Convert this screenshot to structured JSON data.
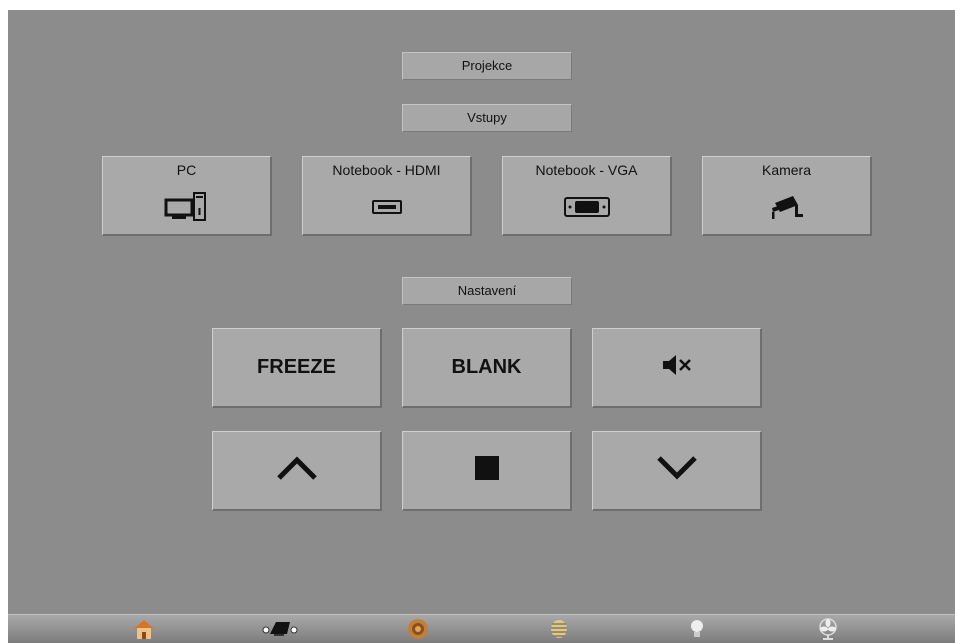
{
  "sections": {
    "projekce": "Projekce",
    "vstupy": "Vstupy",
    "nastaveni": "Nastavení"
  },
  "inputs": [
    {
      "label": "PC",
      "icon": "desktop-computer-icon"
    },
    {
      "label": "Notebook - HDMI",
      "icon": "hdmi-port-icon"
    },
    {
      "label": "Notebook - VGA",
      "icon": "vga-port-icon"
    },
    {
      "label": "Kamera",
      "icon": "security-camera-icon"
    }
  ],
  "controls": {
    "freeze": "FREEZE",
    "blank": "BLANK",
    "mute_icon": "mute-icon",
    "up_icon": "chevron-up-icon",
    "stop_icon": "stop-icon",
    "down_icon": "chevron-down-icon"
  },
  "nav": [
    "home-icon",
    "projector-icon",
    "speaker-icon",
    "blinds-icon",
    "light-bulb-icon",
    "fan-icon"
  ],
  "colors": {
    "panel": "#8c8c8c",
    "button": "#a9a9a9",
    "text": "#111111"
  }
}
